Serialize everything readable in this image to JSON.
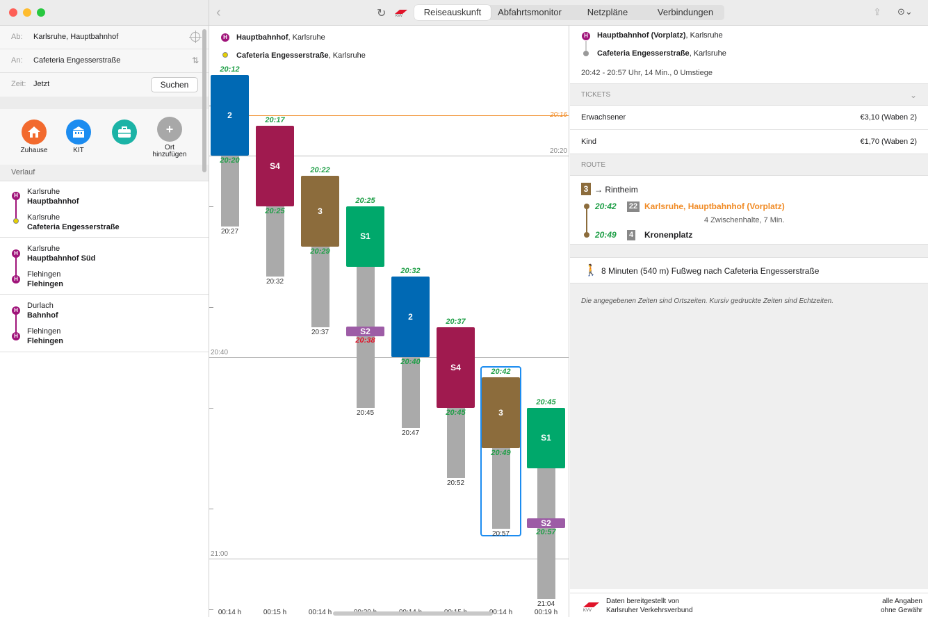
{
  "sidebar": {
    "from_label": "Ab:",
    "from_value": "Karlsruhe, Hauptbahnhof",
    "to_label": "An:",
    "to_value": "Cafeteria Engesserstraße",
    "time_label": "Zeit:",
    "time_value": "Jetzt",
    "search_button": "Suchen",
    "favorites": [
      {
        "label": "Zuhause",
        "icon": "house-icon",
        "color": "#f26a2e"
      },
      {
        "label": "KIT",
        "icon": "building-icon",
        "color": "#1c8cf0"
      },
      {
        "label": "",
        "icon": "briefcase-icon",
        "color": "#1bb3a6"
      },
      {
        "label": "Ort\nhinzufügen",
        "icon": "plus-icon",
        "color": "#a8a8a8"
      }
    ],
    "history_header": "Verlauf",
    "history": [
      {
        "from_city": "Karlsruhe",
        "from_stop": "Hauptbahnhof",
        "to_city": "Karlsruhe",
        "to_stop": "Cafeteria Engesserstraße"
      },
      {
        "from_city": "Karlsruhe",
        "from_stop": "Hauptbahnhof Süd",
        "to_city": "Flehingen",
        "to_stop": "Flehingen"
      },
      {
        "from_city": "Durlach",
        "from_stop": "Bahnhof",
        "to_city": "Flehingen",
        "to_stop": "Flehingen"
      }
    ]
  },
  "toolbar": {
    "tabs": [
      "Reiseauskunft",
      "Abfahrtsmonitor",
      "Netzpläne",
      "Verbindungen"
    ],
    "active_tab": "Reiseauskunft"
  },
  "timeline": {
    "origin_stop": "Hauptbahnhof",
    "origin_city": ", Karlsruhe",
    "dest_stop": "Cafeteria Engesserstraße",
    "dest_city": ", Karlsruhe",
    "now_time": "20:16",
    "grid_labels": [
      "20:20",
      "20:40",
      "21:00"
    ],
    "connections": [
      {
        "line": "2",
        "color": "#0069b4",
        "dep": "20:12",
        "arr": "20:20",
        "walk_end": "20:27",
        "duration": "00:14 h"
      },
      {
        "line": "S4",
        "color": "#a01a4f",
        "dep": "20:17",
        "arr": "20:25",
        "walk_end": "20:32",
        "duration": "00:15 h"
      },
      {
        "line": "3",
        "color": "#8c6c3c",
        "dep": "20:22",
        "arr": "20:29",
        "walk_end": "20:37",
        "duration": "00:14 h"
      },
      {
        "line": "S1",
        "color": "#00a86b",
        "dep": "20:25",
        "second_line": "S2",
        "second_color": "#9d5ca6",
        "second_time": "20:38",
        "walk_end": "20:45",
        "duration": "00:20 h"
      },
      {
        "line": "2",
        "color": "#0069b4",
        "dep": "20:32",
        "arr": "20:40",
        "walk_end": "20:47",
        "duration": "00:14 h"
      },
      {
        "line": "S4",
        "color": "#a01a4f",
        "dep": "20:37",
        "arr": "20:45",
        "walk_end": "20:52",
        "duration": "00:15 h"
      },
      {
        "line": "3",
        "color": "#8c6c3c",
        "dep": "20:42",
        "arr": "20:49",
        "walk_end": "20:57",
        "duration": "00:14 h"
      },
      {
        "line": "S1",
        "color": "#00a86b",
        "dep": "20:45",
        "second_line": "S2",
        "second_color": "#9d5ca6",
        "second_time": "20:57",
        "walk_end": "21:04",
        "duration": "00:19 h"
      }
    ]
  },
  "detail": {
    "origin_stop": "Hauptbahnhof (Vorplatz)",
    "origin_city": ", Karlsruhe",
    "dest_stop": "Cafeteria Engesserstraße",
    "dest_city": ", Karlsruhe",
    "summary": "20:42 - 20:57 Uhr, 14 Min., 0 Umstiege",
    "tickets_header": "TICKETS",
    "tickets": [
      {
        "label": "Erwachsener",
        "price": "€3,10 (Waben 2)"
      },
      {
        "label": "Kind",
        "price": "€1,70 (Waben 2)"
      }
    ],
    "route_header": "ROUTE",
    "route": {
      "line": "3",
      "direction": "→ Rintheim",
      "dep_time": "20:42",
      "dep_platform": "22",
      "dep_stop": "Karlsruhe, Hauptbahnhof (Vorplatz)",
      "intermediate": "4 Zwischenhalte, 7 Min.",
      "arr_time": "20:49",
      "arr_platform": "4",
      "arr_stop": "Kronenplatz"
    },
    "walk": "8 Minuten (540 m) Fußweg nach Cafeteria Engesserstraße",
    "note": "Die angegebenen Zeiten sind Ortszeiten. Kursiv gedruckte Zeiten sind Echtzeiten.",
    "footer_source_line1": "Daten bereitgestellt von",
    "footer_source_line2": "Karlsruher Verkehrsverbund",
    "footer_disclaimer_line1": "alle Angaben",
    "footer_disclaimer_line2": "ohne Gewähr"
  }
}
